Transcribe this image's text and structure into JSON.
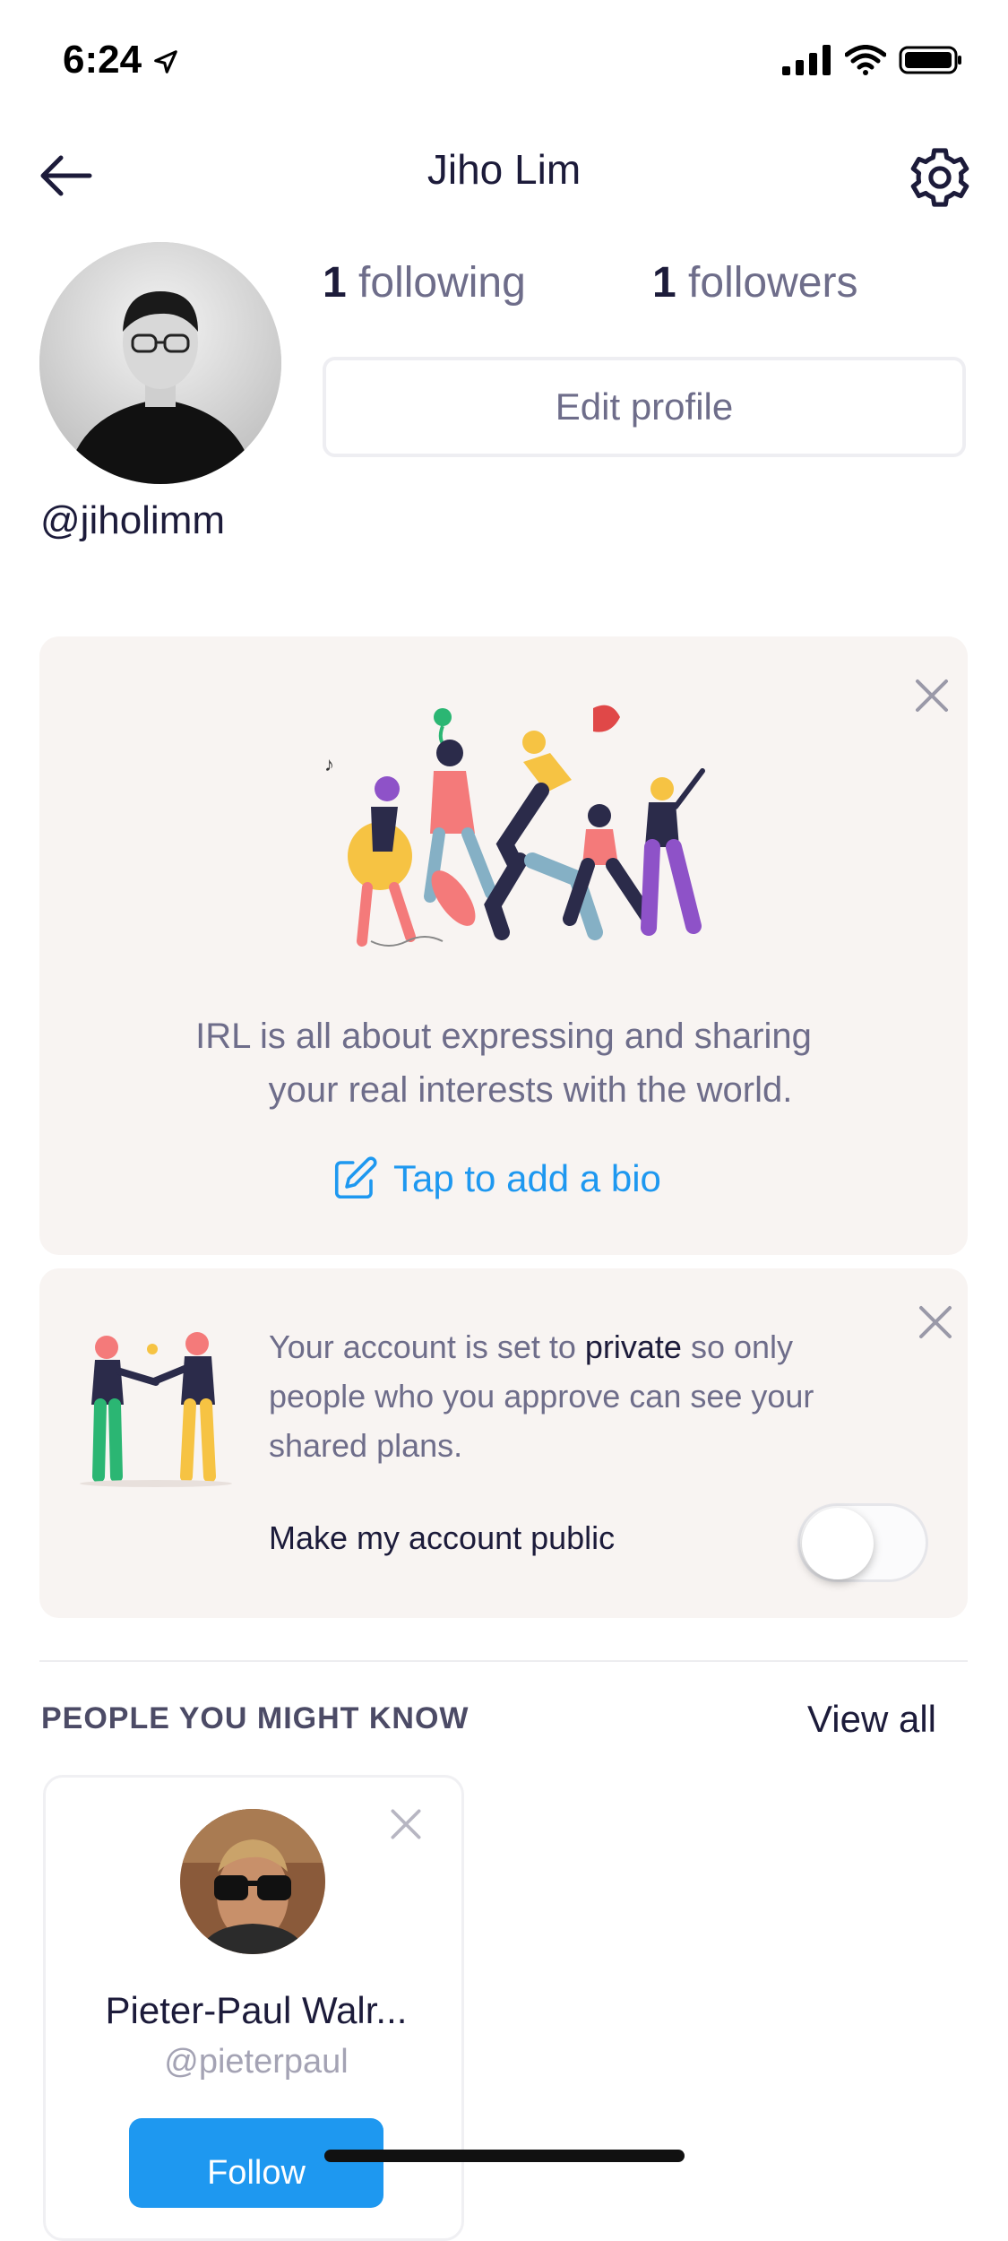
{
  "status_bar": {
    "time": "6:24"
  },
  "header": {
    "title": "Jiho Lim"
  },
  "profile": {
    "handle": "@jiholimm",
    "following_count": "1",
    "following_label": "following",
    "followers_count": "1",
    "followers_label": "followers",
    "edit_button": "Edit profile"
  },
  "bio_card": {
    "line1": "IRL is all about expressing and sharing",
    "line2": "your real interests with the world.",
    "add_bio": "Tap to add a bio"
  },
  "private_card": {
    "text_before": "Your account is set to ",
    "text_emphasis": "private",
    "text_after": " so only people who you approve can see your shared plans.",
    "toggle_label": "Make my account public",
    "toggle_on": false
  },
  "suggestions": {
    "title": "PEOPLE YOU MIGHT KNOW",
    "view_all": "View all",
    "people": [
      {
        "name": "Pieter-Paul Walr...",
        "handle": "@pieterpaul",
        "follow_label": "Follow"
      }
    ]
  },
  "colors": {
    "accent": "#1e98f0",
    "card_bg": "#f8f4f2",
    "text_primary": "#1c1b3a",
    "text_secondary": "#6e6d8a"
  }
}
